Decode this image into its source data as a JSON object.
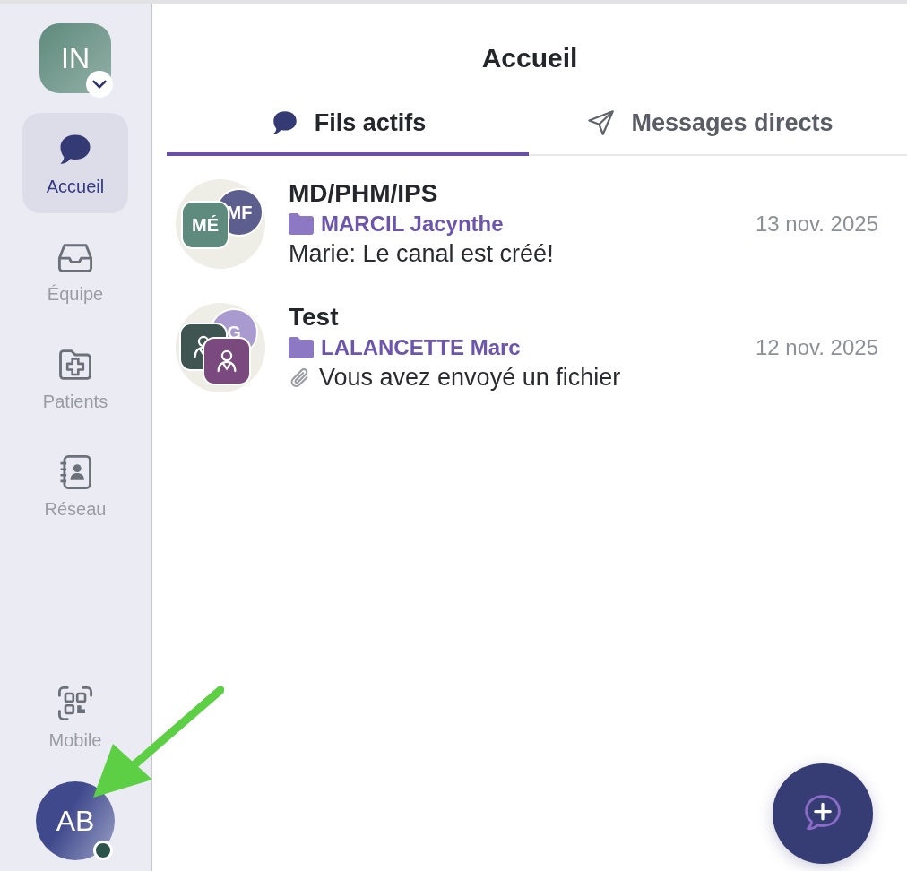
{
  "workspace": {
    "initials": "IN"
  },
  "sidebar": {
    "items": [
      {
        "label": "Accueil",
        "selected": true
      },
      {
        "label": "Équipe",
        "selected": false
      },
      {
        "label": "Patients",
        "selected": false
      },
      {
        "label": "Réseau",
        "selected": false
      }
    ],
    "bottom_item": {
      "label": "Mobile"
    },
    "user": {
      "initials": "AB",
      "online": true
    }
  },
  "header": {
    "title": "Accueil"
  },
  "tabs": [
    {
      "label": "Fils actifs",
      "selected": true
    },
    {
      "label": "Messages directs",
      "selected": false
    }
  ],
  "threads": [
    {
      "title": "MD/PHM/IPS",
      "patient": "MARCIL Jacynthe",
      "date": "13 nov. 2025",
      "preview": "Marie: Le canal est créé!",
      "attachment": false,
      "avatars": [
        {
          "kind": "round",
          "text": "MF",
          "color": "#5c5e8e"
        },
        {
          "kind": "tile",
          "text": "MÉ",
          "color": "#5f8a7e"
        }
      ]
    },
    {
      "title": "Test",
      "patient": "LALANCETTE Marc",
      "date": "12 nov. 2025",
      "preview": "Vous avez envoyé un fichier",
      "attachment": true,
      "avatars": [
        {
          "kind": "round",
          "text": "G",
          "color": "#a99ad0"
        },
        {
          "kind": "person",
          "color": "#3e5552"
        },
        {
          "kind": "person",
          "color": "#7a4a7e"
        }
      ]
    }
  ]
}
